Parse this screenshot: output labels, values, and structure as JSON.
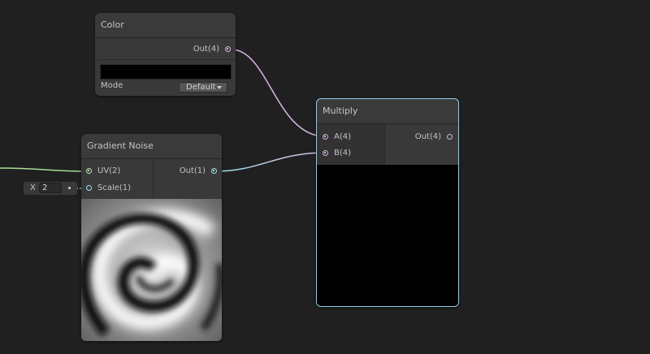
{
  "colors": {
    "background": "#202020",
    "node_body": "#393939",
    "vector4_port": "#d6aee0",
    "vector2_port": "#b7e8a7",
    "float_port": "#9fe1ef",
    "selection_outline": "#8fd2ee"
  },
  "color_node": {
    "title": "Color",
    "output_label": "Out(4)",
    "swatch_color": "#000000",
    "mode_label": "Mode",
    "mode_value": "Default"
  },
  "gradient_noise_node": {
    "title": "Gradient Noise",
    "input_uv": "UV(2)",
    "input_scale": "Scale(1)",
    "output_label": "Out(1)",
    "scale_field_axis": "X",
    "scale_field_value": "2",
    "preview_icon": "swirl-noise-preview"
  },
  "multiply_node": {
    "title": "Multiply",
    "input_a": "A(4)",
    "input_b": "B(4)",
    "output_label": "Out(4)",
    "preview_color": "#000000"
  }
}
